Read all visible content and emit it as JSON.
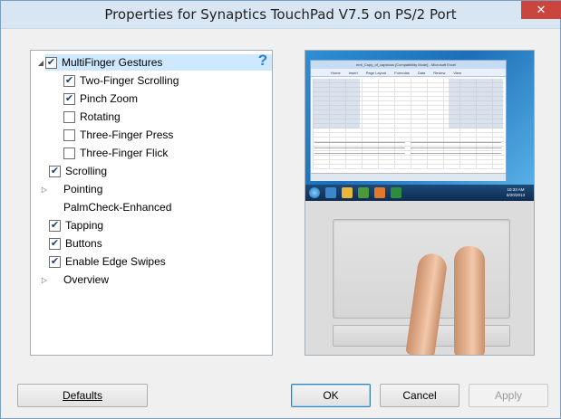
{
  "window": {
    "title": "Properties for Synaptics TouchPad V7.5 on PS/2 Port",
    "close_glyph": "✕"
  },
  "tree": {
    "items": [
      {
        "label": "MultiFinger Gestures",
        "checked": true,
        "expander": "expanded"
      },
      {
        "label": "Two-Finger Scrolling",
        "checked": true
      },
      {
        "label": "Pinch Zoom",
        "checked": true
      },
      {
        "label": "Rotating",
        "checked": false
      },
      {
        "label": "Three-Finger Press",
        "checked": false
      },
      {
        "label": "Three-Finger Flick",
        "checked": false
      },
      {
        "label": "Scrolling",
        "checked": true
      },
      {
        "label": "Pointing",
        "expander": "collapsed"
      },
      {
        "label": "PalmCheck-Enhanced"
      },
      {
        "label": "Tapping",
        "checked": true
      },
      {
        "label": "Buttons",
        "checked": true
      },
      {
        "label": "Enable Edge Swipes",
        "checked": true
      },
      {
        "label": "Overview",
        "expander": "collapsed"
      }
    ],
    "help_icon": "help-question-icon"
  },
  "preview": {
    "excel_title": "emt_Copy_of_capstous [Compatibility Mode] - Microsoft Excel",
    "ribbon_tabs": [
      "Home",
      "Insert",
      "Page Layout",
      "Formulas",
      "Data",
      "Review",
      "View"
    ],
    "clock": {
      "time": "10:33 AM",
      "date": "6/20/2013"
    }
  },
  "buttons": {
    "defaults": "Defaults",
    "ok": "OK",
    "cancel": "Cancel",
    "apply": "Apply"
  },
  "colors": {
    "selection": "#cde8ff",
    "check": "#1d3c7a",
    "help": "#2f7bd3",
    "close": "#c9453e"
  }
}
